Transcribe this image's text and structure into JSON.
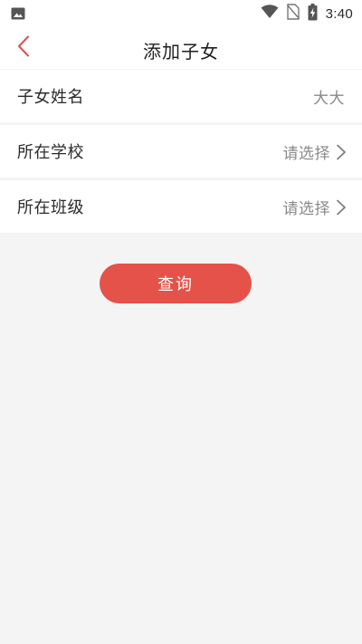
{
  "status_bar": {
    "time": "3:40",
    "icons": [
      "image-notification-icon",
      "wifi-icon",
      "no-sim-icon",
      "battery-charging-icon"
    ]
  },
  "header": {
    "title": "添加子女",
    "back_icon": "chevron-left-icon",
    "accent_color": "#d9534f"
  },
  "form": {
    "rows": [
      {
        "label": "子女姓名",
        "value": "大大"
      },
      {
        "label": "所在学校",
        "value": "请选择",
        "icon": "chevron-right-icon"
      },
      {
        "label": "所在班级",
        "value": "请选择",
        "icon": "chevron-right-icon"
      }
    ]
  },
  "actions": {
    "query_label": "查询",
    "button_color": "#e4524a"
  }
}
